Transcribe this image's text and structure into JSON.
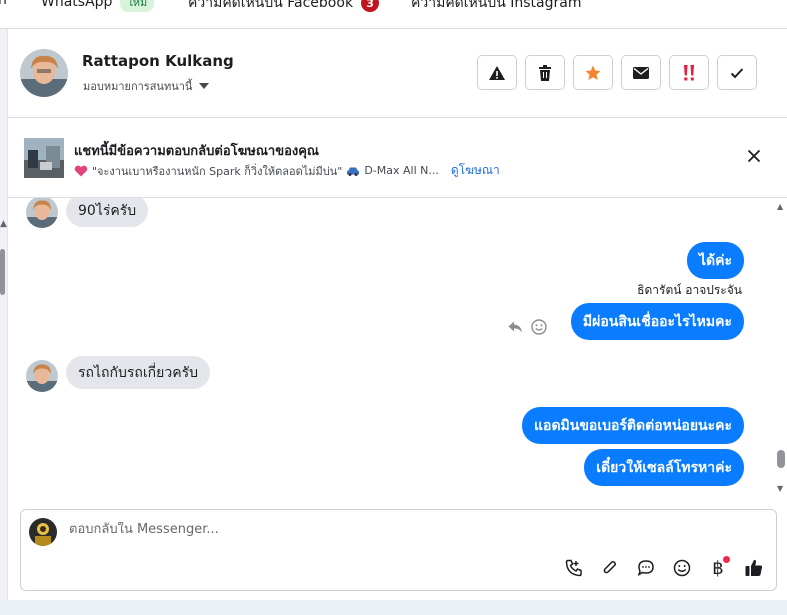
{
  "tabs": [
    {
      "label": "WhatsApp",
      "badge": "ใหม่"
    },
    {
      "label": "ความคิดเห็นบน Facebook",
      "badge": "3"
    },
    {
      "label": "ความคิดเห็นบน Instagram"
    }
  ],
  "partial_tab": "n",
  "header": {
    "contact_name": "Rattapon Kulkang",
    "assign_label": "มอบหมายการสนทนานี้",
    "actions": [
      {
        "icon": "warning-icon"
      },
      {
        "icon": "trash-icon"
      },
      {
        "icon": "star-icon",
        "color": "#f5852f"
      },
      {
        "icon": "envelope-icon"
      },
      {
        "icon": "double-exclamation-icon",
        "color": "#e41e3f"
      },
      {
        "icon": "check-icon"
      }
    ]
  },
  "ad": {
    "title": "แชทนี้มีข้อความตอบกลับต่อโฆษณาของคุณ",
    "text": "\"จะงานเบาหรืองานหนัก Spark ก็วิ่งให้ตลอดไม่มีบ่น\"",
    "model": "D-Max All N...",
    "link": "ดูโฆษณา"
  },
  "messages": [
    {
      "dir": "in",
      "text": "90ไร่ครับ"
    },
    {
      "dir": "out",
      "text": "ได้ค่ะ"
    },
    {
      "dir": "out",
      "sender": "ธิดารัตน์ อาจประจัน",
      "text": "มีผ่อนสินเชื่ออะไรไหมคะ"
    },
    {
      "dir": "in",
      "text": "รถไถกับรถเกี่ยวครับ"
    },
    {
      "dir": "out",
      "text": "แอดมินขอเบอร์ติดต่อหน่อยนะคะ"
    },
    {
      "dir": "out",
      "text": "เดี๋ยวให้เซลล์โทรหาค่ะ"
    }
  ],
  "composer": {
    "placeholder": "ตอบกลับใน Messenger...",
    "tools": [
      "phone-icon",
      "paperclip-icon",
      "chat-bubble-icon",
      "emoji-icon",
      "baht-icon",
      "thumbs-up-icon"
    ],
    "baht_symbol": "฿"
  },
  "colors": {
    "outgoing": "#0a7cff",
    "incoming": "#e4e6eb",
    "link": "#216fdb",
    "accent_red": "#c0141f"
  }
}
